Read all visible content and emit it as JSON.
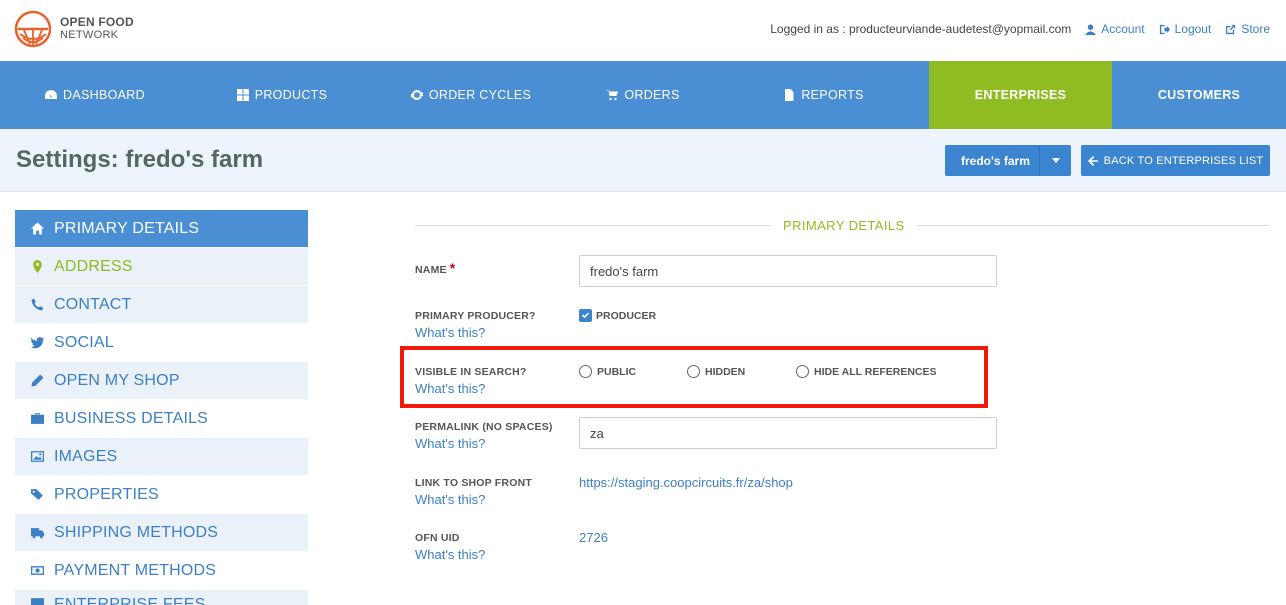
{
  "header": {
    "logo_line1": "OPEN FOOD",
    "logo_line2": "NETWORK",
    "logged_in": "Logged in as : producteurviande-audetest@yopmail.com",
    "account": "Account",
    "logout": "Logout",
    "store": "Store"
  },
  "nav": {
    "dashboard": "DASHBOARD",
    "products": "PRODUCTS",
    "order_cycles": "ORDER CYCLES",
    "orders": "ORDERS",
    "reports": "REPORTS",
    "enterprises": "ENTERPRISES",
    "customers": "CUSTOMERS"
  },
  "titlebar": {
    "title": "Settings: fredo's farm",
    "enterprise_select": "fredo's farm",
    "back_button": "BACK TO ENTERPRISES LIST"
  },
  "sidebar": {
    "items": [
      {
        "label": "PRIMARY DETAILS",
        "icon": "home-icon"
      },
      {
        "label": "ADDRESS",
        "icon": "map-marker-icon"
      },
      {
        "label": "CONTACT",
        "icon": "phone-icon"
      },
      {
        "label": "SOCIAL",
        "icon": "twitter-icon"
      },
      {
        "label": "OPEN MY SHOP",
        "icon": "pencil-icon"
      },
      {
        "label": "BUSINESS DETAILS",
        "icon": "briefcase-icon"
      },
      {
        "label": "IMAGES",
        "icon": "image-icon"
      },
      {
        "label": "PROPERTIES",
        "icon": "tags-icon"
      },
      {
        "label": "SHIPPING METHODS",
        "icon": "truck-icon"
      },
      {
        "label": "PAYMENT METHODS",
        "icon": "money-icon"
      },
      {
        "label": "ENTERPRISE FEES",
        "icon": "fees-icon"
      }
    ]
  },
  "form": {
    "section_title": "PRIMARY DETAILS",
    "whats_this": "What's this?",
    "name_label": "NAME",
    "name_required": "*",
    "name_value": "fredo's farm",
    "primary_producer_label": "PRIMARY PRODUCER?",
    "producer_checkbox": "PRODUCER",
    "visible_label": "VISIBLE IN SEARCH?",
    "visible_options": [
      "PUBLIC",
      "HIDDEN",
      "HIDE ALL REFERENCES"
    ],
    "permalink_label": "PERMALINK (NO SPACES)",
    "permalink_value": "za",
    "link_label": "LINK TO SHOP FRONT",
    "link_value": "https://staging.coopcircuits.fr/za/shop",
    "uid_label": "OFN UID",
    "uid_value": "2726"
  },
  "colors": {
    "nav_blue": "#4a8fd3",
    "active_green": "#8fbc23",
    "link_blue": "#3b7fc4",
    "highlight_red": "#f0190a"
  }
}
